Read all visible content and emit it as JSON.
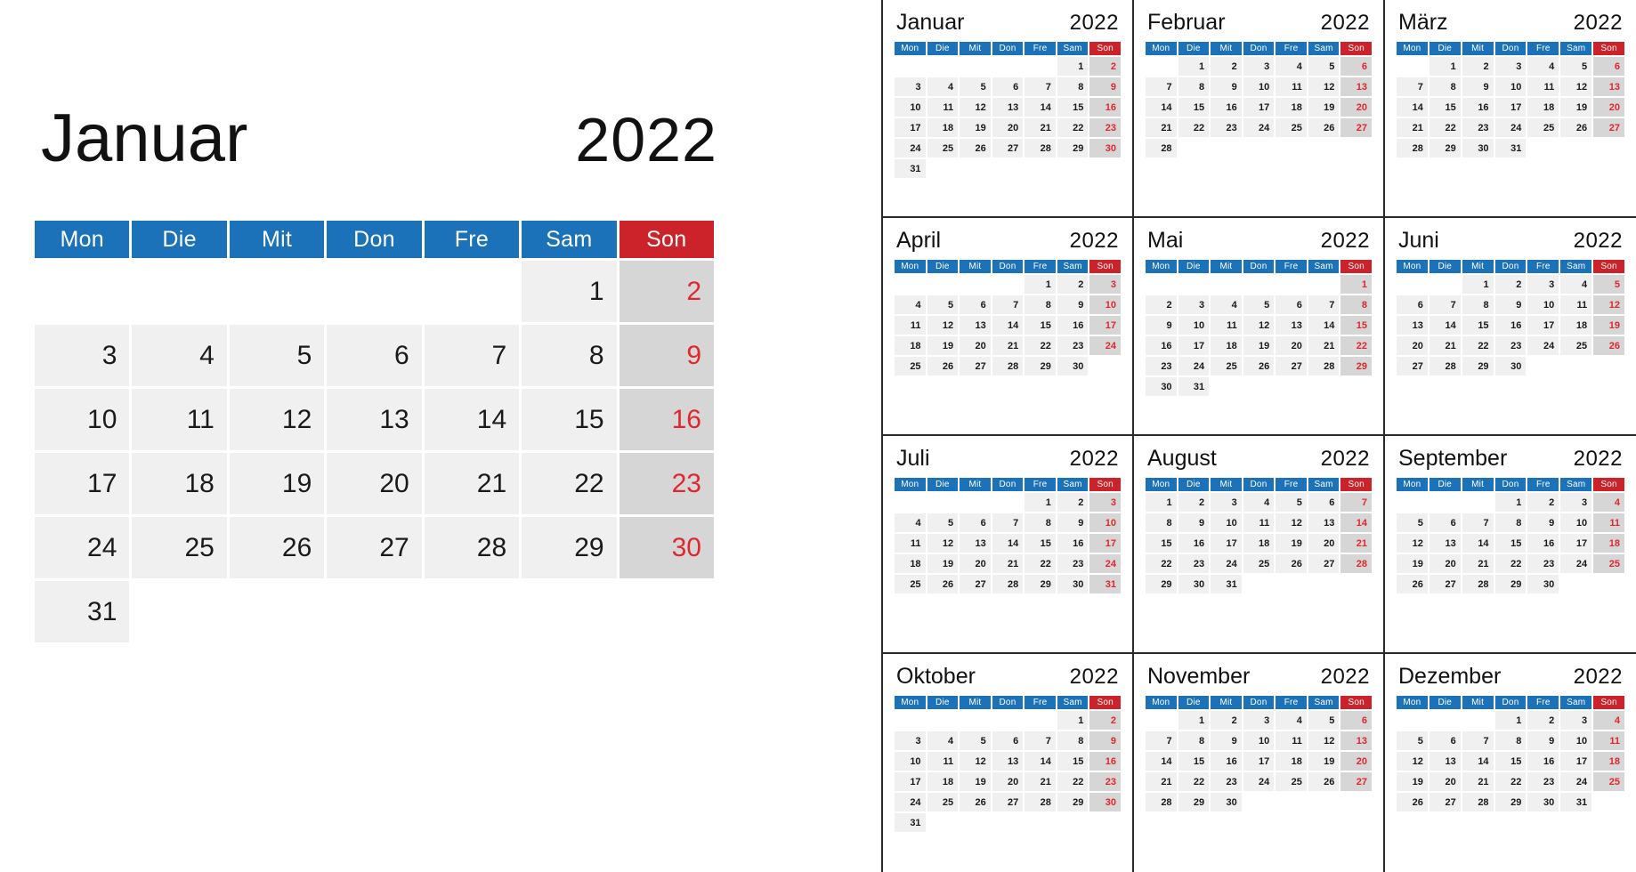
{
  "colors": {
    "header_blue": "#1b72b8",
    "header_red": "#cc2229",
    "day_cell": "#f0f0f0",
    "sunday_cell": "#d6d6d6",
    "sunday_text": "#e0262e",
    "text": "#1a1a1a",
    "divider": "#2a2a2a"
  },
  "year": "2022",
  "weekday_headers": [
    "Mon",
    "Die",
    "Mit",
    "Don",
    "Fre",
    "Sam",
    "Son"
  ],
  "featured": {
    "month": "Januar",
    "year": "2022",
    "first_weekday_index": 5,
    "days_in_month": 31,
    "weeks": [
      [
        "",
        "",
        "",
        "",
        "",
        "1",
        "2"
      ],
      [
        "3",
        "4",
        "5",
        "6",
        "7",
        "8",
        "9"
      ],
      [
        "10",
        "11",
        "12",
        "13",
        "14",
        "15",
        "16"
      ],
      [
        "17",
        "18",
        "19",
        "20",
        "21",
        "22",
        "23"
      ],
      [
        "24",
        "25",
        "26",
        "27",
        "28",
        "29",
        "30"
      ],
      [
        "31",
        "",
        "",
        "",
        "",
        "",
        ""
      ]
    ]
  },
  "months": [
    {
      "month": "Januar",
      "year": "2022",
      "days_in_month": 31,
      "first_weekday_index": 5,
      "weeks": [
        [
          "",
          "",
          "",
          "",
          "",
          "1",
          "2"
        ],
        [
          "3",
          "4",
          "5",
          "6",
          "7",
          "8",
          "9"
        ],
        [
          "10",
          "11",
          "12",
          "13",
          "14",
          "15",
          "16"
        ],
        [
          "17",
          "18",
          "19",
          "20",
          "21",
          "22",
          "23"
        ],
        [
          "24",
          "25",
          "26",
          "27",
          "28",
          "29",
          "30"
        ],
        [
          "31",
          "",
          "",
          "",
          "",
          "",
          ""
        ]
      ]
    },
    {
      "month": "Februar",
      "year": "2022",
      "days_in_month": 28,
      "first_weekday_index": 1,
      "weeks": [
        [
          "",
          "1",
          "2",
          "3",
          "4",
          "5",
          "6"
        ],
        [
          "7",
          "8",
          "9",
          "10",
          "11",
          "12",
          "13"
        ],
        [
          "14",
          "15",
          "16",
          "17",
          "18",
          "19",
          "20"
        ],
        [
          "21",
          "22",
          "23",
          "24",
          "25",
          "26",
          "27"
        ],
        [
          "28",
          "",
          "",
          "",
          "",
          "",
          ""
        ],
        [
          "",
          "",
          "",
          "",
          "",
          "",
          ""
        ]
      ]
    },
    {
      "month": "März",
      "year": "2022",
      "days_in_month": 31,
      "first_weekday_index": 1,
      "weeks": [
        [
          "",
          "1",
          "2",
          "3",
          "4",
          "5",
          "6"
        ],
        [
          "7",
          "8",
          "9",
          "10",
          "11",
          "12",
          "13"
        ],
        [
          "14",
          "15",
          "16",
          "17",
          "18",
          "19",
          "20"
        ],
        [
          "21",
          "22",
          "23",
          "24",
          "25",
          "26",
          "27"
        ],
        [
          "28",
          "29",
          "30",
          "31",
          "",
          "",
          ""
        ],
        [
          "",
          "",
          "",
          "",
          "",
          "",
          ""
        ]
      ]
    },
    {
      "month": "April",
      "year": "2022",
      "days_in_month": 30,
      "first_weekday_index": 4,
      "weeks": [
        [
          "",
          "",
          "",
          "",
          "1",
          "2",
          "3"
        ],
        [
          "4",
          "5",
          "6",
          "7",
          "8",
          "9",
          "10"
        ],
        [
          "11",
          "12",
          "13",
          "14",
          "15",
          "16",
          "17"
        ],
        [
          "18",
          "19",
          "20",
          "21",
          "22",
          "23",
          "24"
        ],
        [
          "25",
          "26",
          "27",
          "28",
          "29",
          "30",
          ""
        ],
        [
          "",
          "",
          "",
          "",
          "",
          "",
          ""
        ]
      ]
    },
    {
      "month": "Mai",
      "year": "2022",
      "days_in_month": 31,
      "first_weekday_index": 6,
      "weeks": [
        [
          "",
          "",
          "",
          "",
          "",
          "",
          "1"
        ],
        [
          "2",
          "3",
          "4",
          "5",
          "6",
          "7",
          "8"
        ],
        [
          "9",
          "10",
          "11",
          "12",
          "13",
          "14",
          "15"
        ],
        [
          "16",
          "17",
          "18",
          "19",
          "20",
          "21",
          "22"
        ],
        [
          "23",
          "24",
          "25",
          "26",
          "27",
          "28",
          "29"
        ],
        [
          "30",
          "31",
          "",
          "",
          "",
          "",
          ""
        ]
      ]
    },
    {
      "month": "Juni",
      "year": "2022",
      "days_in_month": 30,
      "first_weekday_index": 2,
      "weeks": [
        [
          "",
          "",
          "1",
          "2",
          "3",
          "4",
          "5"
        ],
        [
          "6",
          "7",
          "8",
          "9",
          "10",
          "11",
          "12"
        ],
        [
          "13",
          "14",
          "15",
          "16",
          "17",
          "18",
          "19"
        ],
        [
          "20",
          "21",
          "22",
          "23",
          "24",
          "25",
          "26"
        ],
        [
          "27",
          "28",
          "29",
          "30",
          "",
          "",
          ""
        ],
        [
          "",
          "",
          "",
          "",
          "",
          "",
          ""
        ]
      ]
    },
    {
      "month": "Juli",
      "year": "2022",
      "days_in_month": 31,
      "first_weekday_index": 4,
      "weeks": [
        [
          "",
          "",
          "",
          "",
          "1",
          "2",
          "3"
        ],
        [
          "4",
          "5",
          "6",
          "7",
          "8",
          "9",
          "10"
        ],
        [
          "11",
          "12",
          "13",
          "14",
          "15",
          "16",
          "17"
        ],
        [
          "18",
          "19",
          "20",
          "21",
          "22",
          "23",
          "24"
        ],
        [
          "25",
          "26",
          "27",
          "28",
          "29",
          "30",
          "31"
        ],
        [
          "",
          "",
          "",
          "",
          "",
          "",
          ""
        ]
      ]
    },
    {
      "month": "August",
      "year": "2022",
      "days_in_month": 31,
      "first_weekday_index": 0,
      "weeks": [
        [
          "1",
          "2",
          "3",
          "4",
          "5",
          "6",
          "7"
        ],
        [
          "8",
          "9",
          "10",
          "11",
          "12",
          "13",
          "14"
        ],
        [
          "15",
          "16",
          "17",
          "18",
          "19",
          "20",
          "21"
        ],
        [
          "22",
          "23",
          "24",
          "25",
          "26",
          "27",
          "28"
        ],
        [
          "29",
          "30",
          "31",
          "",
          "",
          "",
          ""
        ],
        [
          "",
          "",
          "",
          "",
          "",
          "",
          ""
        ]
      ]
    },
    {
      "month": "September",
      "year": "2022",
      "days_in_month": 30,
      "first_weekday_index": 3,
      "weeks": [
        [
          "",
          "",
          "",
          "1",
          "2",
          "3",
          "4"
        ],
        [
          "5",
          "6",
          "7",
          "8",
          "9",
          "10",
          "11"
        ],
        [
          "12",
          "13",
          "14",
          "15",
          "16",
          "17",
          "18"
        ],
        [
          "19",
          "20",
          "21",
          "22",
          "23",
          "24",
          "25"
        ],
        [
          "26",
          "27",
          "28",
          "29",
          "30",
          "",
          ""
        ],
        [
          "",
          "",
          "",
          "",
          "",
          "",
          ""
        ]
      ]
    },
    {
      "month": "Oktober",
      "year": "2022",
      "days_in_month": 31,
      "first_weekday_index": 5,
      "weeks": [
        [
          "",
          "",
          "",
          "",
          "",
          "1",
          "2"
        ],
        [
          "3",
          "4",
          "5",
          "6",
          "7",
          "8",
          "9"
        ],
        [
          "10",
          "11",
          "12",
          "13",
          "14",
          "15",
          "16"
        ],
        [
          "17",
          "18",
          "19",
          "20",
          "21",
          "22",
          "23"
        ],
        [
          "24",
          "25",
          "26",
          "27",
          "28",
          "29",
          "30"
        ],
        [
          "31",
          "",
          "",
          "",
          "",
          "",
          ""
        ]
      ]
    },
    {
      "month": "November",
      "year": "2022",
      "days_in_month": 30,
      "first_weekday_index": 1,
      "weeks": [
        [
          "",
          "1",
          "2",
          "3",
          "4",
          "5",
          "6"
        ],
        [
          "7",
          "8",
          "9",
          "10",
          "11",
          "12",
          "13"
        ],
        [
          "14",
          "15",
          "16",
          "17",
          "18",
          "19",
          "20"
        ],
        [
          "21",
          "22",
          "23",
          "24",
          "25",
          "26",
          "27"
        ],
        [
          "28",
          "29",
          "30",
          "",
          "",
          "",
          ""
        ],
        [
          "",
          "",
          "",
          "",
          "",
          "",
          ""
        ]
      ]
    },
    {
      "month": "Dezember",
      "year": "2022",
      "days_in_month": 31,
      "first_weekday_index": 3,
      "weeks": [
        [
          "",
          "",
          "",
          "1",
          "2",
          "3",
          "4"
        ],
        [
          "5",
          "6",
          "7",
          "8",
          "9",
          "10",
          "11"
        ],
        [
          "12",
          "13",
          "14",
          "15",
          "16",
          "17",
          "18"
        ],
        [
          "19",
          "20",
          "21",
          "22",
          "23",
          "24",
          "25"
        ],
        [
          "26",
          "27",
          "28",
          "29",
          "30",
          "31",
          ""
        ],
        [
          "",
          "",
          "",
          "",
          "",
          "",
          ""
        ]
      ]
    }
  ]
}
